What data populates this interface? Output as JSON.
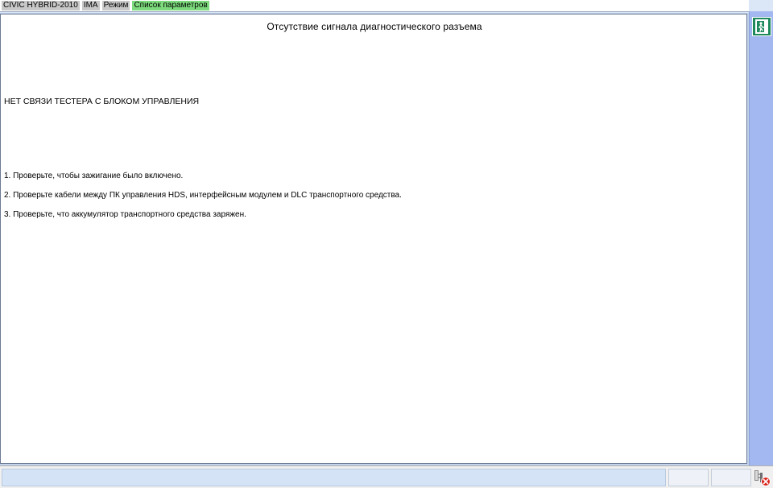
{
  "breadcrumb": {
    "items": [
      {
        "label": "CIVIC HYBRID-2010",
        "active": false
      },
      {
        "label": "IMA",
        "active": false
      },
      {
        "label": "Режим",
        "active": false
      },
      {
        "label": "Список параметров",
        "active": true
      }
    ]
  },
  "main": {
    "title": "Отсутствие сигнала диагностического разъема",
    "headline": "НЕТ СВЯЗИ ТЕСТЕРА С БЛОКОМ УПРАВЛЕНИЯ",
    "steps": [
      "1. Проверьте, чтобы зажигание было включено.",
      "2. Проверьте кабели между ПК управления HDS, интерфейсным модулем и DLC транспортного средства.",
      "3. Проверьте, что аккумулятор транспортного средства заряжен."
    ]
  },
  "sidebar": {
    "exit_icon": "exit-door-icon"
  },
  "statusbar": {
    "message": "",
    "cell1": "",
    "cell2": "",
    "connection_icon": "connection-error-icon"
  },
  "colors": {
    "background": "#c3d3ec",
    "side_column": "#a3b8f0",
    "active_crumb": "#7ddb7d",
    "inactive_crumb": "#c8c8c8",
    "exit_button": "#1e8a5c",
    "error_red": "#d9261c"
  }
}
